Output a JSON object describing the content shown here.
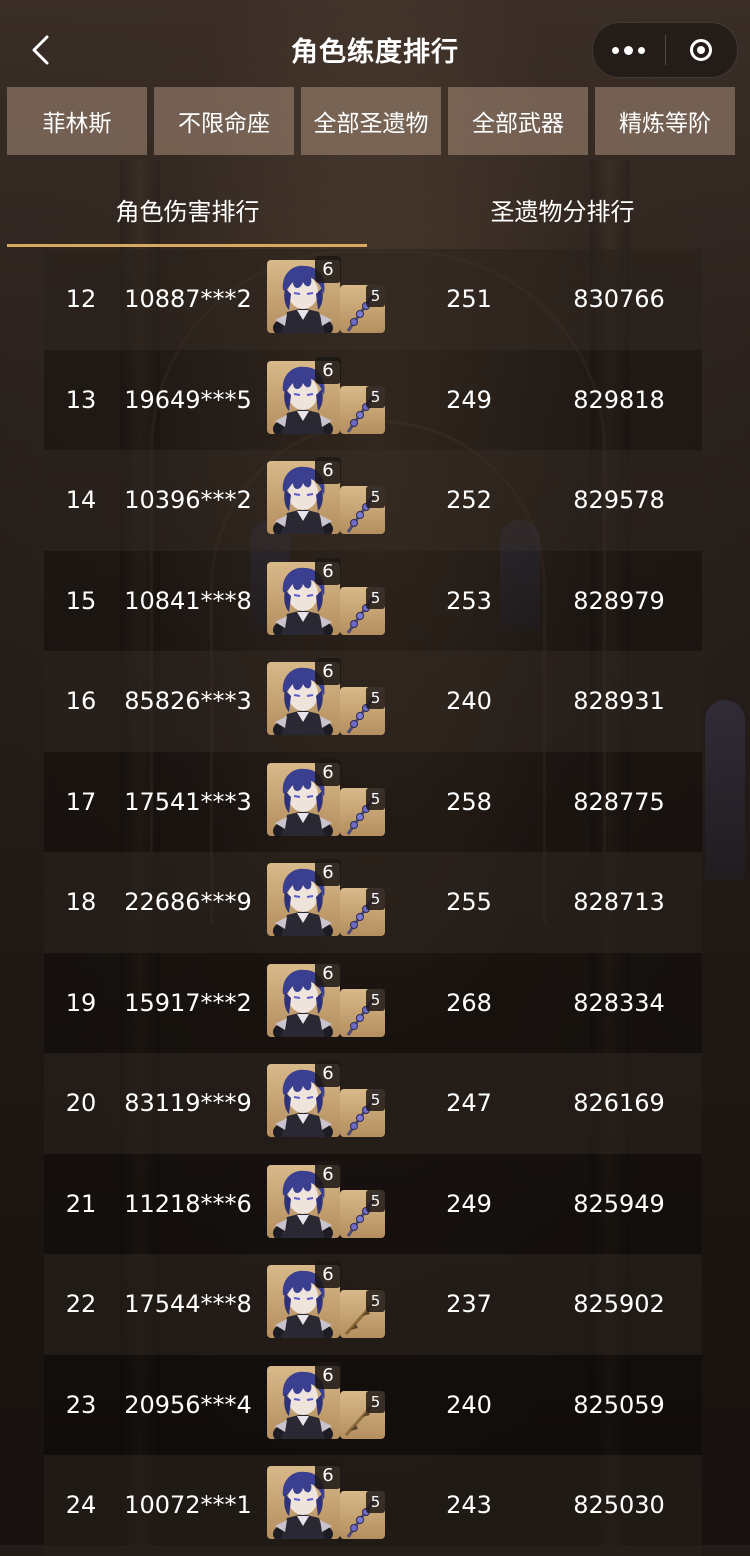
{
  "header": {
    "title": "角色练度排行"
  },
  "filters": [
    {
      "label": "菲林斯"
    },
    {
      "label": "不限命座"
    },
    {
      "label": "全部圣遗物"
    },
    {
      "label": "全部武器"
    },
    {
      "label": "精炼等阶"
    }
  ],
  "tabs": [
    {
      "label": "角色伤害排行",
      "active": true
    },
    {
      "label": "圣遗物分排行",
      "active": false
    }
  ],
  "rows": [
    {
      "rank": "12",
      "uid": "10887***2",
      "constellation": "6",
      "refinement": "5",
      "weapon": "polearm-chain",
      "artifact_score": "251",
      "damage": "830766"
    },
    {
      "rank": "13",
      "uid": "19649***5",
      "constellation": "6",
      "refinement": "5",
      "weapon": "polearm-chain",
      "artifact_score": "249",
      "damage": "829818"
    },
    {
      "rank": "14",
      "uid": "10396***2",
      "constellation": "6",
      "refinement": "5",
      "weapon": "polearm-chain",
      "artifact_score": "252",
      "damage": "829578"
    },
    {
      "rank": "15",
      "uid": "10841***8",
      "constellation": "6",
      "refinement": "5",
      "weapon": "polearm-chain",
      "artifact_score": "253",
      "damage": "828979"
    },
    {
      "rank": "16",
      "uid": "85826***3",
      "constellation": "6",
      "refinement": "5",
      "weapon": "polearm-chain",
      "artifact_score": "240",
      "damage": "828931"
    },
    {
      "rank": "17",
      "uid": "17541***3",
      "constellation": "6",
      "refinement": "5",
      "weapon": "polearm-chain",
      "artifact_score": "258",
      "damage": "828775"
    },
    {
      "rank": "18",
      "uid": "22686***9",
      "constellation": "6",
      "refinement": "5",
      "weapon": "polearm-chain",
      "artifact_score": "255",
      "damage": "828713"
    },
    {
      "rank": "19",
      "uid": "15917***2",
      "constellation": "6",
      "refinement": "5",
      "weapon": "polearm-chain",
      "artifact_score": "268",
      "damage": "828334"
    },
    {
      "rank": "20",
      "uid": "83119***9",
      "constellation": "6",
      "refinement": "5",
      "weapon": "polearm-chain",
      "artifact_score": "247",
      "damage": "826169"
    },
    {
      "rank": "21",
      "uid": "11218***6",
      "constellation": "6",
      "refinement": "5",
      "weapon": "polearm-chain",
      "artifact_score": "249",
      "damage": "825949"
    },
    {
      "rank": "22",
      "uid": "17544***8",
      "constellation": "6",
      "refinement": "5",
      "weapon": "polearm-gold",
      "artifact_score": "237",
      "damage": "825902"
    },
    {
      "rank": "23",
      "uid": "20956***4",
      "constellation": "6",
      "refinement": "5",
      "weapon": "polearm-gold",
      "artifact_score": "240",
      "damage": "825059"
    },
    {
      "rank": "24",
      "uid": "10072***1",
      "constellation": "6",
      "refinement": "5",
      "weapon": "polearm-chain",
      "artifact_score": "243",
      "damage": "825030"
    }
  ],
  "colors": {
    "tab_underline": "#d9a95e",
    "icon_bg": "#c8a474",
    "filter_bg": "#8f7a68"
  }
}
